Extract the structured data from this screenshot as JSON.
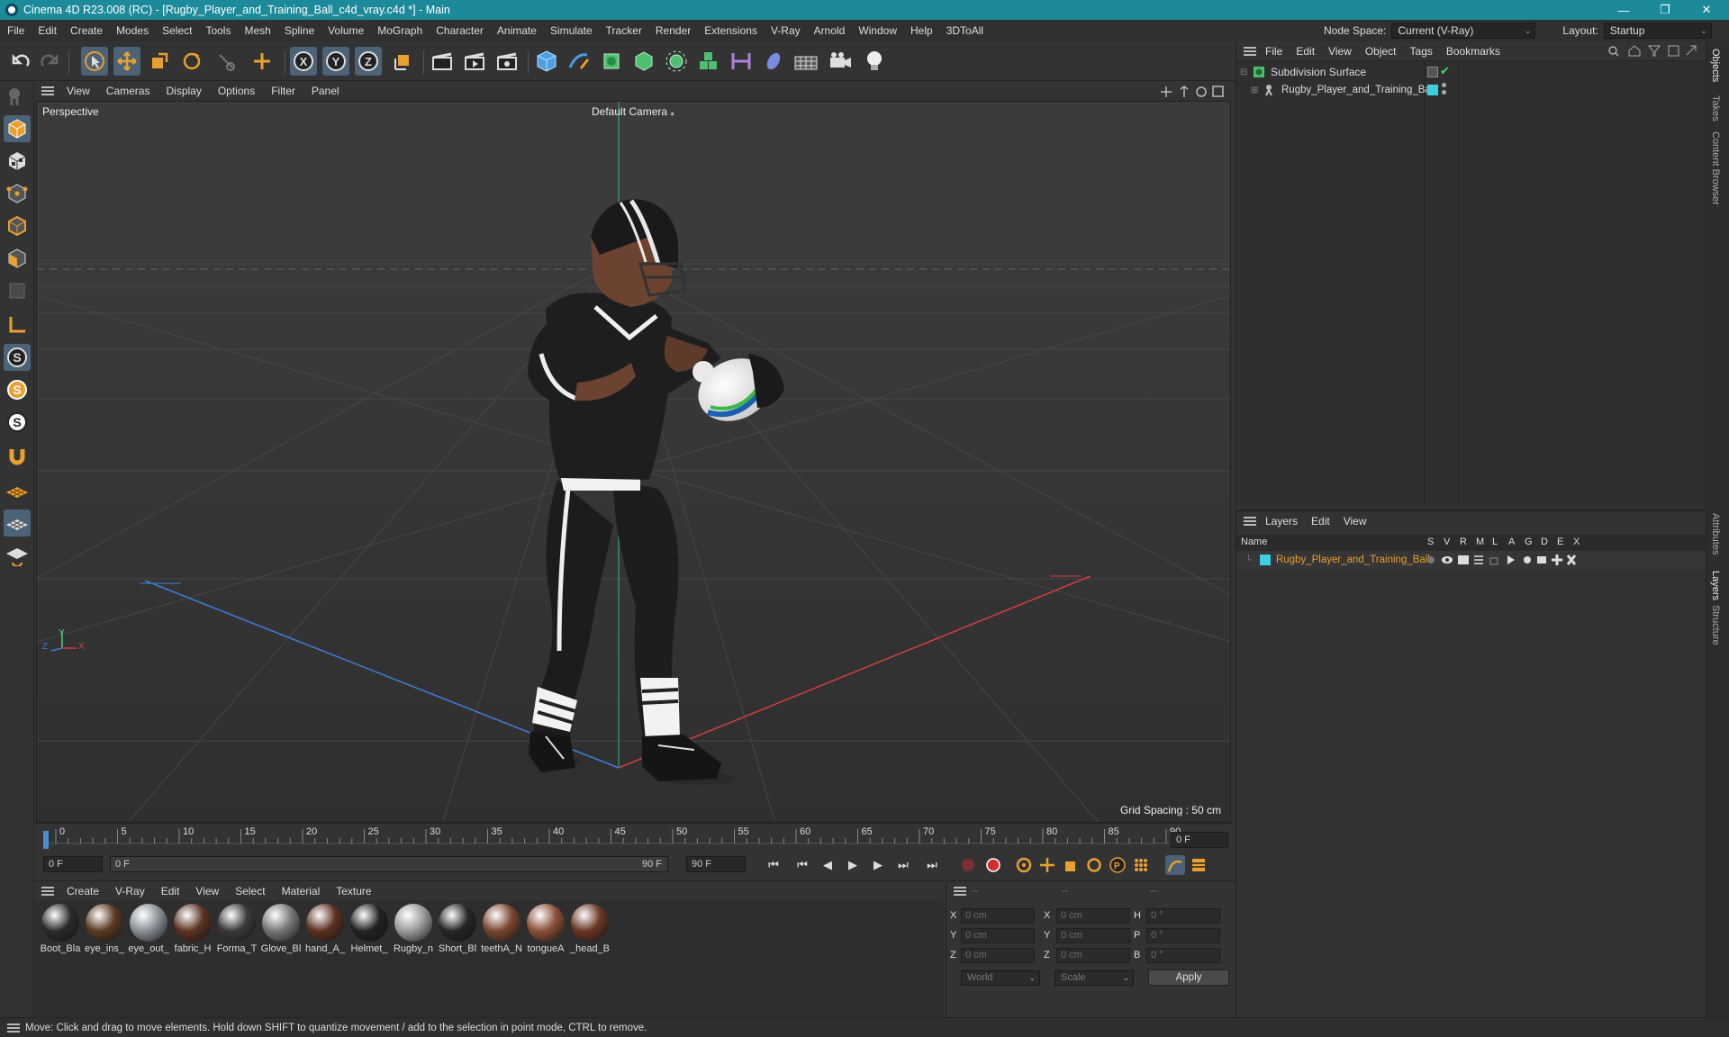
{
  "window": {
    "title": "Cinema 4D R23.008 (RC) - [Rugby_Player_and_Training_Ball_c4d_vray.c4d *] - Main",
    "minimize": "—",
    "maximize": "❐",
    "close": "✕"
  },
  "menubar": {
    "items": [
      "File",
      "Edit",
      "Create",
      "Modes",
      "Select",
      "Tools",
      "Mesh",
      "Spline",
      "Volume",
      "MoGraph",
      "Character",
      "Animate",
      "Simulate",
      "Tracker",
      "Render",
      "Extensions",
      "V-Ray",
      "Arnold",
      "Window",
      "Help",
      "3DToAll"
    ],
    "node_space_label": "Node Space:",
    "node_space_value": "Current (V-Ray)",
    "layout_label": "Layout:",
    "layout_value": "Startup"
  },
  "viewport": {
    "menu": [
      "View",
      "Cameras",
      "Display",
      "Options",
      "Filter",
      "Panel"
    ],
    "label": "Perspective",
    "camera": "Default Camera",
    "grid_spacing": "Grid Spacing : 50 cm",
    "axis_x": "X",
    "axis_y": "Y",
    "axis_z": "Z"
  },
  "timeline": {
    "ticks": [
      "0",
      "5",
      "10",
      "15",
      "20",
      "25",
      "30",
      "35",
      "40",
      "45",
      "50",
      "55",
      "60",
      "65",
      "70",
      "75",
      "80",
      "85",
      "90"
    ],
    "current_frame": "0 F",
    "start_frame": "0 F",
    "range_start": "0 F",
    "range_end": "90 F",
    "end_frame": "90 F"
  },
  "materials": {
    "menu": [
      "Create",
      "V-Ray",
      "Edit",
      "View",
      "Select",
      "Material",
      "Texture"
    ],
    "items": [
      {
        "label": "Boot_Bla",
        "color": "#2a2a2a"
      },
      {
        "label": "eye_ins_",
        "color": "#5a3a22"
      },
      {
        "label": "eye_out_",
        "color": "#8a8f96"
      },
      {
        "label": "fabric_H",
        "color": "#5c3322"
      },
      {
        "label": "Forma_T",
        "color": "#3a3a3a"
      },
      {
        "label": "Glove_Bl",
        "color": "#777777"
      },
      {
        "label": "hand_A_",
        "color": "#5c3020"
      },
      {
        "label": "Helmet_",
        "color": "#222222"
      },
      {
        "label": "Rugby_n",
        "color": "#9a9a9a"
      },
      {
        "label": "Short_Bl",
        "color": "#262626"
      },
      {
        "label": "teethA_N",
        "color": "#7a4630"
      },
      {
        "label": "tongueA",
        "color": "#8a5038"
      },
      {
        "label": "_head_B",
        "color": "#6a3624"
      }
    ]
  },
  "coordinates": {
    "header": [
      "--",
      "--",
      "--"
    ],
    "rows": [
      {
        "l1": "X",
        "v1": "0 cm",
        "l2": "X",
        "v2": "0 cm",
        "l3": "H",
        "v3": "0 °"
      },
      {
        "l1": "Y",
        "v1": "0 cm",
        "l2": "Y",
        "v2": "0 cm",
        "l3": "P",
        "v3": "0 °"
      },
      {
        "l1": "Z",
        "v1": "0 cm",
        "l2": "Z",
        "v2": "0 cm",
        "l3": "B",
        "v3": "0 °"
      }
    ],
    "mode": "World",
    "transform": "Scale",
    "apply": "Apply"
  },
  "objects": {
    "menu": [
      "File",
      "Edit",
      "View",
      "Object",
      "Tags",
      "Bookmarks"
    ],
    "items": [
      {
        "name": "Subdivision Surface",
        "color": "#4cd964"
      },
      {
        "name": "Rugby_Player_and_Training_Ball",
        "color": "#3fd0e0"
      }
    ]
  },
  "layers": {
    "menu": [
      "Layers",
      "Edit",
      "View"
    ],
    "columns": [
      "Name",
      "S",
      "V",
      "R",
      "M",
      "L",
      "A",
      "G",
      "D",
      "E",
      "X"
    ],
    "items": [
      {
        "name": "Rugby_Player_and_Training_Ball",
        "color": "#3fd0e0"
      }
    ]
  },
  "right_tabs": [
    "Objects",
    "Takes",
    "Content Browser",
    "Attributes",
    "Layers",
    "Structure"
  ],
  "status": "Move: Click and drag to move elements. Hold down SHIFT to quantize movement / add to the selection in point mode, CTRL to remove."
}
